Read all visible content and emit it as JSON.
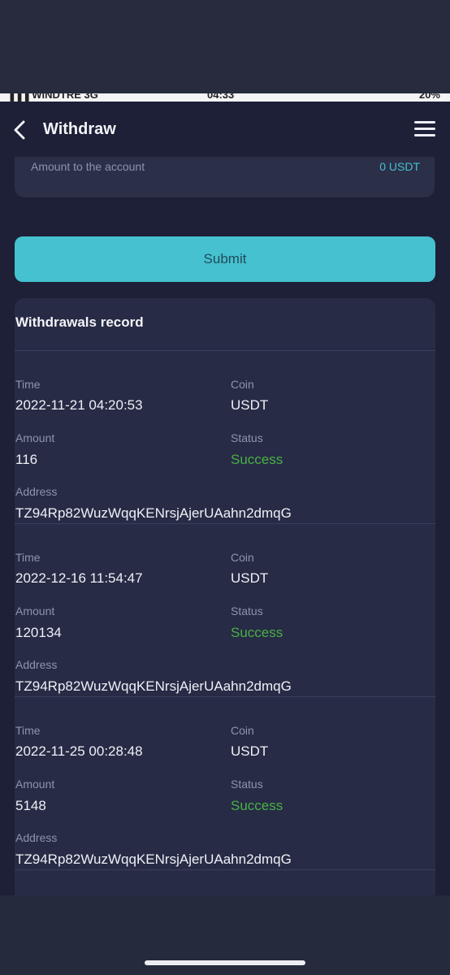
{
  "statusbar": {
    "carrier": "▐▐▐ WINDTRE 3G",
    "time": "04:33",
    "battery": "20%"
  },
  "header": {
    "title": "Withdraw",
    "back_icon": "chevron-left-icon",
    "menu_icon": "hamburger-menu-icon"
  },
  "amount": {
    "label": "Amount to the account",
    "value": "0 USDT"
  },
  "submit": {
    "label": "Submit"
  },
  "records": {
    "title": "Withdrawals record",
    "labels": {
      "time": "Time",
      "coin": "Coin",
      "amount": "Amount",
      "status": "Status",
      "address": "Address"
    },
    "items": [
      {
        "time": "2022-11-21 04:20:53",
        "coin": "USDT",
        "amount": "116",
        "status": "Success",
        "address": "TZ94Rp82WuzWqqKENrsjAjerUAahn2dmqG"
      },
      {
        "time": "2022-12-16 11:54:47",
        "coin": "USDT",
        "amount": "120134",
        "status": "Success",
        "address": "TZ94Rp82WuzWqqKENrsjAjerUAahn2dmqG"
      },
      {
        "time": "2022-11-25 00:28:48",
        "coin": "USDT",
        "amount": "5148",
        "status": "Success",
        "address": "TZ94Rp82WuzWqqKENrsjAjerUAahn2dmqG"
      }
    ]
  },
  "colors": {
    "accent": "#45c1cf",
    "success": "#49b046",
    "background": "#1d2036"
  }
}
